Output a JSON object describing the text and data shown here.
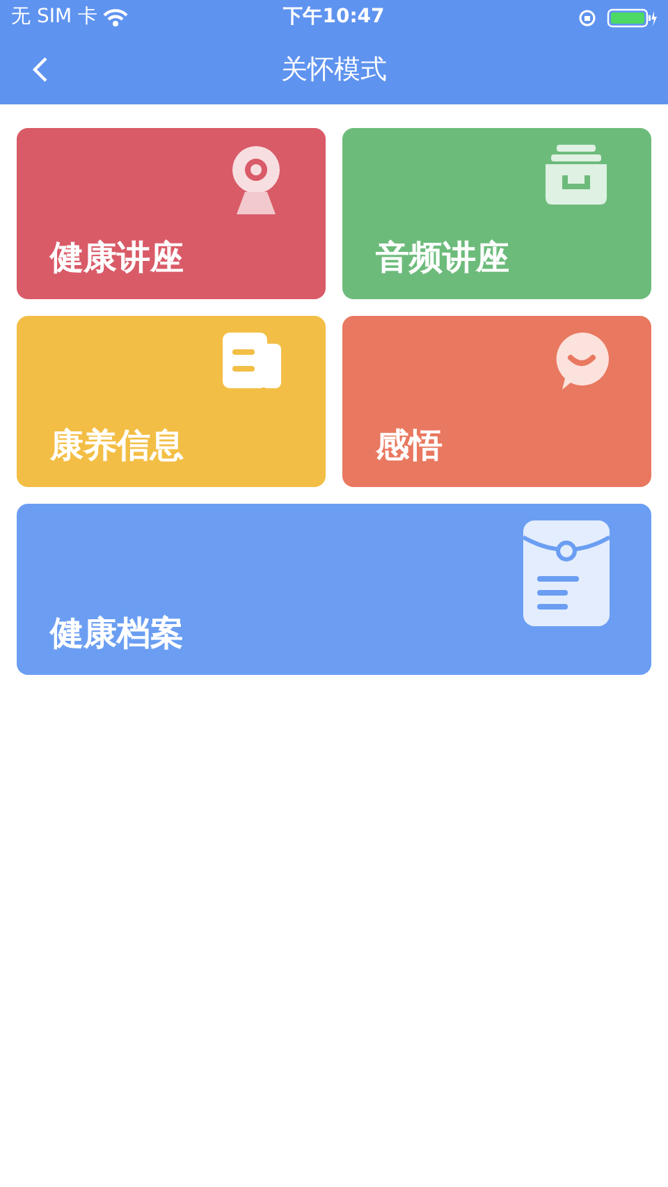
{
  "status_bar": {
    "carrier": "无 SIM 卡",
    "time": "下午10:47"
  },
  "nav": {
    "title": "关怀模式"
  },
  "cards": [
    {
      "label": "健康讲座",
      "kind": "camera",
      "color": "#d95b68",
      "wide": false
    },
    {
      "label": "音频讲座",
      "kind": "drawer",
      "color": "#6dbb7b",
      "wide": false
    },
    {
      "label": "康养信息",
      "kind": "document",
      "color": "#f3be45",
      "wide": false
    },
    {
      "label": "感悟",
      "kind": "chat",
      "color": "#e97860",
      "wide": false
    },
    {
      "label": "健康档案",
      "kind": "envelope",
      "color": "#6b9ef2",
      "wide": true
    }
  ]
}
